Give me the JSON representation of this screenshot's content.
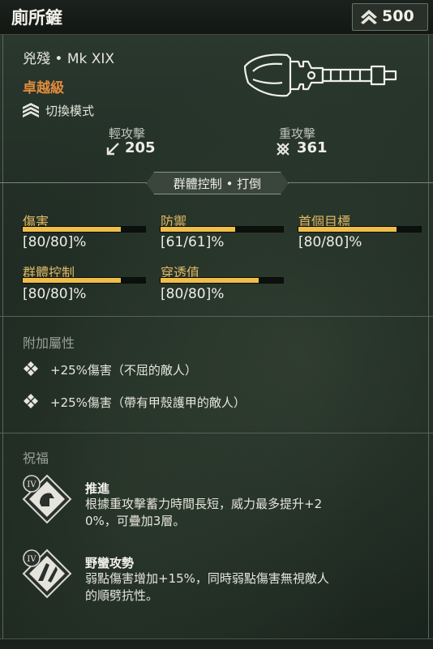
{
  "header": {
    "title": "廁所鏟",
    "cost_icon": "upgrade-chevrons-icon",
    "cost": "500"
  },
  "weapon": {
    "subtitle": "兇殘 • Mk XIX",
    "rarity": "卓越級",
    "rarity_color": "#e08b3c",
    "mode_icon": "switch-mode-chevrons-icon",
    "mode": "切換模式",
    "image_icon": "shovel-weapon-icon"
  },
  "attacks": {
    "light": {
      "label": "輕攻擊",
      "icon": "light-attack-icon",
      "value": "205"
    },
    "heavy": {
      "label": "重攻擊",
      "icon": "heavy-attack-icon",
      "value": "361"
    }
  },
  "tag": "群體控制 • 打倒",
  "stats": [
    {
      "name": "傷害",
      "value": "[80/80]%",
      "fill": 0.8
    },
    {
      "name": "防禦",
      "value": "[61/61]%",
      "fill": 0.61
    },
    {
      "name": "首個目標",
      "value": "[80/80]%",
      "fill": 0.8
    },
    {
      "name": "群體控制",
      "value": "[80/80]%",
      "fill": 0.8
    },
    {
      "name": "穿透值",
      "value": "[80/80]%",
      "fill": 0.8
    }
  ],
  "bar_color": "#f0be48",
  "perks": {
    "title": "附加屬性",
    "items": [
      {
        "icon": "perk-diamond-icon",
        "text": "+25%傷害（不屈的敵人）"
      },
      {
        "icon": "perk-diamond-icon",
        "text": "+25%傷害（帶有甲殼護甲的敵人）"
      }
    ]
  },
  "blessings": {
    "title": "祝福",
    "items": [
      {
        "icon": "thrust-blessing-icon",
        "tier": "IV",
        "name": "推進",
        "desc_lines": [
          "根據重攻擊蓄力時間長短，威力最多提升+2",
          "0%，可疊加3層。"
        ]
      },
      {
        "icon": "savage-attack-blessing-icon",
        "tier": "IV",
        "name": "野蠻攻勢",
        "desc_lines": [
          "弱點傷害增加+15%，同時弱點傷害無視敵人",
          "的順劈抗性。"
        ]
      }
    ]
  }
}
